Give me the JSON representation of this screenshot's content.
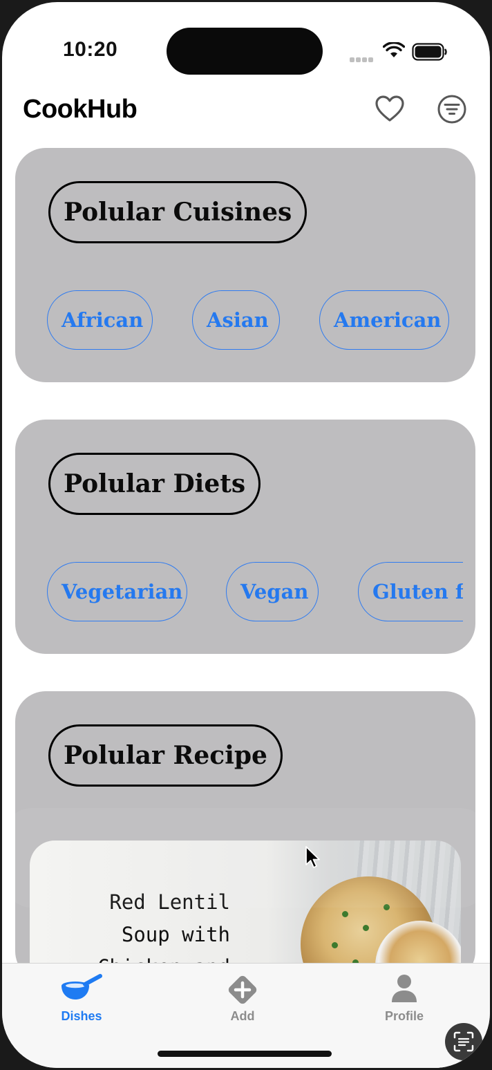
{
  "status_bar": {
    "time": "10:20"
  },
  "header": {
    "title": "CookHub"
  },
  "sections": {
    "cuisines": {
      "title": "Polular Cuisines",
      "chips": [
        "African",
        "Asian",
        "American"
      ]
    },
    "diets": {
      "title": "Polular Diets",
      "chips": [
        "Vegetarian",
        "Vegan",
        "Gluten free"
      ]
    },
    "recipe": {
      "title": "Polular Recipe",
      "card": {
        "name": "Red Lentil Soup with Chicken and"
      }
    }
  },
  "tab_bar": {
    "items": [
      {
        "label": "Dishes",
        "icon": "bowl-icon",
        "active": true
      },
      {
        "label": "Add",
        "icon": "add-diamond-icon",
        "active": false
      },
      {
        "label": "Profile",
        "icon": "person-icon",
        "active": false
      }
    ]
  },
  "colors": {
    "accent": "#2579ef",
    "section_bg": "#bebdbf",
    "inactive_tab": "#8c8c8c"
  }
}
